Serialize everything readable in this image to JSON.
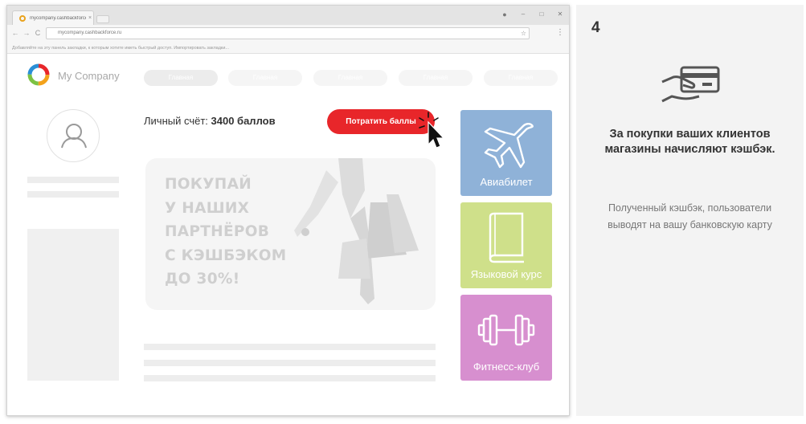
{
  "browser": {
    "tab_title": "mycompany.cashbackforce.ru",
    "tab_close": "×",
    "window_controls": [
      "–",
      "□",
      "✕"
    ],
    "nav": {
      "back": "←",
      "forward": "→",
      "reload": "C"
    },
    "url": "mycompany.cashbackforce.ru",
    "star_icon": "☆",
    "menu_icon": "⋮",
    "bookmark_hint": "Добавляйте на эту панель закладки, к которым хотите иметь быстрый доступ. Импортировать закладки..."
  },
  "site": {
    "company_name": "My Company",
    "nav_items": [
      "Главная",
      "Главная",
      "Главная",
      "Главная",
      "Главная"
    ],
    "account": {
      "label": "Личный счёт:",
      "value": "3400 баллов"
    },
    "spend_button": "Потратить баллы",
    "banner_lines": [
      "ПОКУПАЙ",
      "У НАШИХ",
      "ПАРТНЁРОВ",
      "С КЭШБЭКОМ",
      "ДО 30%!"
    ],
    "tiles": [
      {
        "label": "Авиабилет",
        "color": "#8fb2d8",
        "icon": "airplane-icon"
      },
      {
        "label": "Языковой курс",
        "color": "#cfe08a",
        "icon": "book-icon"
      },
      {
        "label": "Фитнесс-клуб",
        "color": "#d78fcf",
        "icon": "dumbbell-icon"
      }
    ]
  },
  "panel": {
    "step": "4",
    "icon": "hand-card-icon",
    "title": "За покупки ваших клиентов магазины начисляют кэшбэк.",
    "description": "Полученный кэшбэк, пользователи выводят на вашу банковскую карту"
  },
  "colors": {
    "accent_red": "#e8262a",
    "panel_bg": "#f3f3f3"
  }
}
